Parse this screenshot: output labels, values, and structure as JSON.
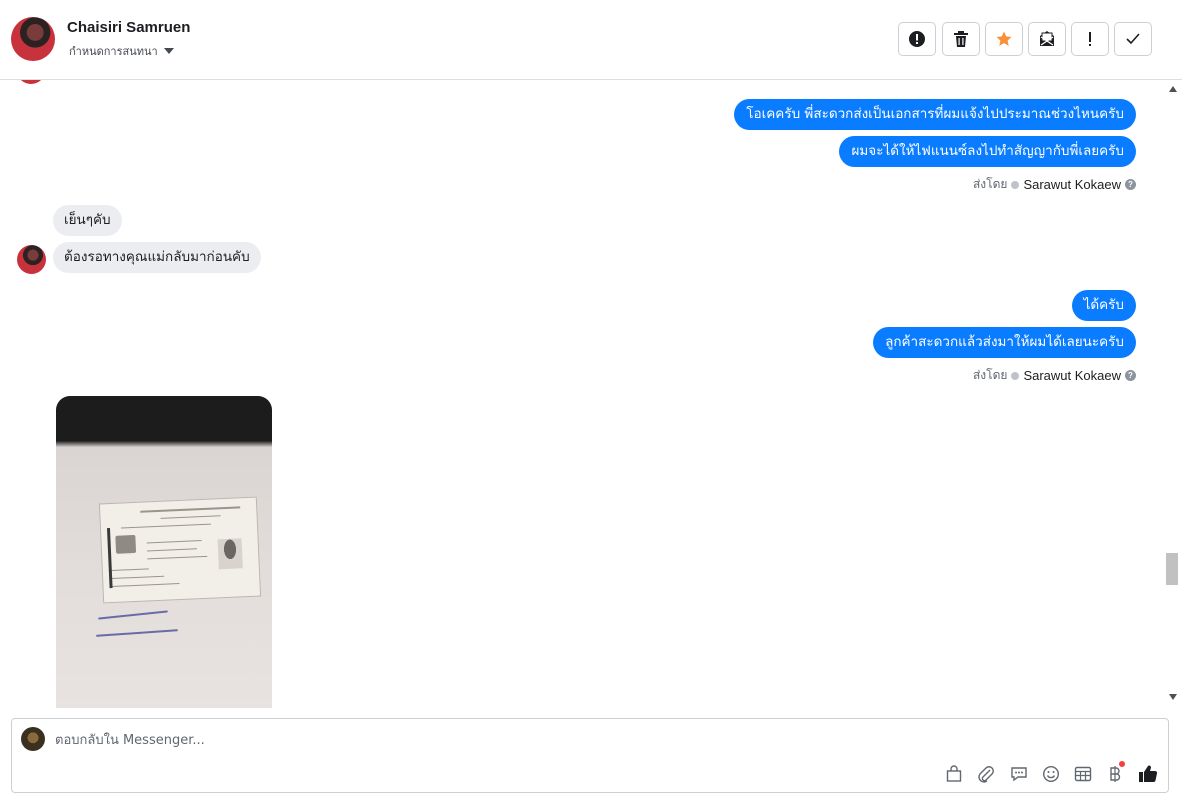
{
  "header": {
    "contact_name": "Chaisiri Samruen",
    "conversation_label": "กำหนดการสนทนา",
    "tools": [
      {
        "name": "report-spam-icon"
      },
      {
        "name": "delete-icon"
      },
      {
        "name": "star-icon",
        "color": "#f7923b"
      },
      {
        "name": "mark-unread-icon"
      },
      {
        "name": "important-icon"
      },
      {
        "name": "done-icon"
      }
    ]
  },
  "thread": {
    "messages": [
      {
        "direction": "out",
        "text": "โอเคครับ พี่สะดวกส่งเป็นเอกสารที่ผมแจ้งไปประมาณช่วงไหนครับ"
      },
      {
        "direction": "out",
        "text": "ผมจะได้ให้ไฟแนนซ์ลงไปทำสัญญากับพี่เลยครับ"
      },
      {
        "direction": "in",
        "text": "เย็นๆคับ"
      },
      {
        "direction": "in",
        "text": "ต้องรอทางคุณแม่กลับมาก่อนคับ"
      },
      {
        "direction": "out",
        "text": "ได้ครับ"
      },
      {
        "direction": "out",
        "text": "ลูกค้าสะดวกแล้วส่งมาให้ผมได้เลยนะครับ"
      }
    ],
    "sent_by": [
      {
        "label": "ส่งโดย",
        "agent": "Sarawut Kokaew",
        "help": "?"
      },
      {
        "label": "ส่งโดย",
        "agent": "Sarawut Kokaew",
        "help": "?"
      }
    ],
    "attachment": {
      "kind": "photo",
      "subject": "id-card-photo"
    }
  },
  "composer": {
    "placeholder": "ตอบกลับใน Messenger...",
    "value": "",
    "icons": [
      "shopping-bag-icon",
      "attachment-icon",
      "saved-replies-icon",
      "emoji-icon",
      "appointment-icon",
      "payment-icon",
      "like-icon"
    ],
    "payment_badge_color": "#fa3e3e"
  },
  "colors": {
    "outgoing_bubble": "#0a7cff",
    "incoming_bubble": "#ebedf0"
  }
}
